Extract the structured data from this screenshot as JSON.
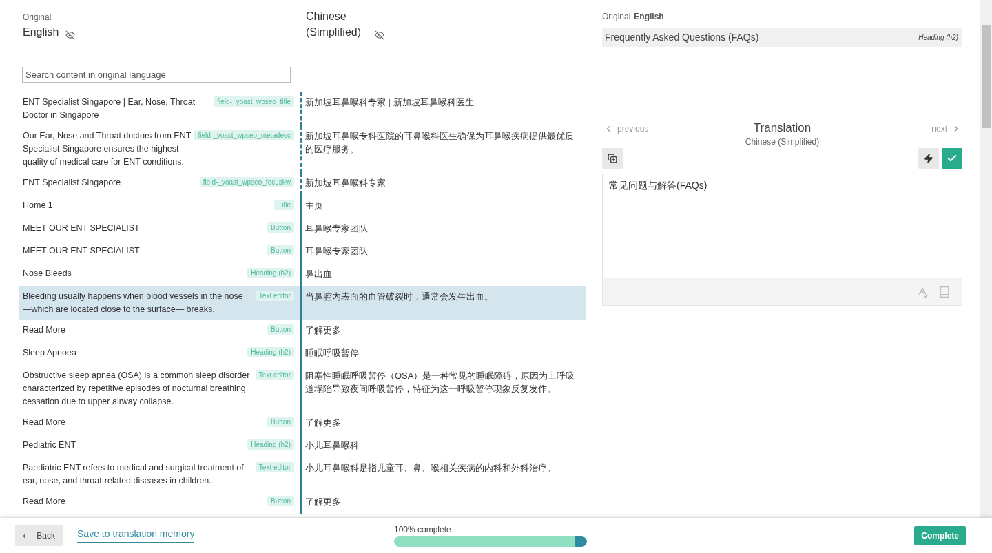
{
  "header": {
    "original_label": "Original",
    "original_language": "English",
    "translation_language": "Chinese (Simplified)"
  },
  "search": {
    "placeholder": "Search content in original language"
  },
  "rows": [
    {
      "original": "ENT Specialist Singapore | Ear, Nose, Throat Doctor in Singapore",
      "tag": "field-_yoast_wpseo_title",
      "translation": "新加坡耳鼻喉科专家 | 新加坡耳鼻喉科医生",
      "kind": "meta",
      "selected": false
    },
    {
      "original": "Our Ear, Nose and Throat doctors from ENT Specialist Singapore ensures the highest quality of medical care for ENT conditions.",
      "tag": "field-_yoast_wpseo_metadesc",
      "translation": "新加坡耳鼻喉专科医院的耳鼻喉科医生确保为耳鼻喉疾病提供最优质的医疗服务。",
      "kind": "meta",
      "selected": false
    },
    {
      "original": "ENT Specialist Singapore",
      "tag": "field-_yoast_wpseo_focuskw",
      "translation": "新加坡耳鼻喉科专家",
      "kind": "meta",
      "selected": false
    },
    {
      "original": "Home 1",
      "tag": "Title",
      "translation": "主页",
      "kind": "content",
      "selected": false
    },
    {
      "original": "MEET OUR ENT SPECIALIST",
      "tag": "Button",
      "translation": "耳鼻喉专家团队",
      "kind": "content",
      "selected": false
    },
    {
      "original": "MEET OUR ENT SPECIALIST",
      "tag": "Button",
      "translation": "耳鼻喉专家团队",
      "kind": "content",
      "selected": false
    },
    {
      "original": "Nose Bleeds",
      "tag": "Heading (h2)",
      "translation": "鼻出血",
      "kind": "content",
      "selected": false
    },
    {
      "original": "Bleeding usually happens when blood vessels in the nose —which are located close to the surface— breaks.",
      "tag": "Text editor",
      "translation": "当鼻腔内表面的血管破裂时，通常会发生出血。",
      "kind": "content",
      "selected": true
    },
    {
      "original": "Read More",
      "tag": "Button",
      "translation": "了解更多",
      "kind": "content",
      "selected": false
    },
    {
      "original": "Sleep Apnoea",
      "tag": "Heading (h2)",
      "translation": "睡眠呼吸暂停",
      "kind": "content",
      "selected": false
    },
    {
      "original": "Obstructive sleep apnea (OSA) is a common sleep disorder characterized by repetitive episodes of nocturnal breathing cessation due to upper airway collapse.",
      "tag": "Text editor",
      "translation": "阻塞性睡眠呼吸暂停（OSA）是一种常见的睡眠障碍，原因为上呼吸道塌陷导致夜间呼吸暂停，特征为这一呼吸暂停现象反复发作。",
      "kind": "content",
      "selected": false
    },
    {
      "original": "Read More",
      "tag": "Button",
      "translation": "了解更多",
      "kind": "content",
      "selected": false
    },
    {
      "original": "Pediatric ENT",
      "tag": "Heading (h2)",
      "translation": "小儿耳鼻喉科",
      "kind": "content",
      "selected": false
    },
    {
      "original": "Paediatric ENT refers to medical and surgical treatment of ear, nose, and throat-related diseases in children.",
      "tag": "Text editor",
      "translation": "小儿耳鼻喉科是指儿童耳、鼻、喉相关疾病的内科和外科治疗。",
      "kind": "content",
      "selected": false
    },
    {
      "original": "Read More",
      "tag": "Button",
      "translation": "了解更多",
      "kind": "content",
      "selected": false
    }
  ],
  "editor": {
    "original_label": "Original",
    "original_language": "English",
    "source_text": "Frequently Asked Questions (FAQs)",
    "source_type": "Heading (h2)",
    "previous": "previous",
    "title": "Translation",
    "language": "Chinese (Simplified)",
    "next": "next",
    "value": "常见问题与解答(FAQs)"
  },
  "footer": {
    "back": "⟵ Back",
    "save": "Save to translation memory",
    "progress_label": "100% complete",
    "level": 1,
    "complete": "Complete"
  }
}
